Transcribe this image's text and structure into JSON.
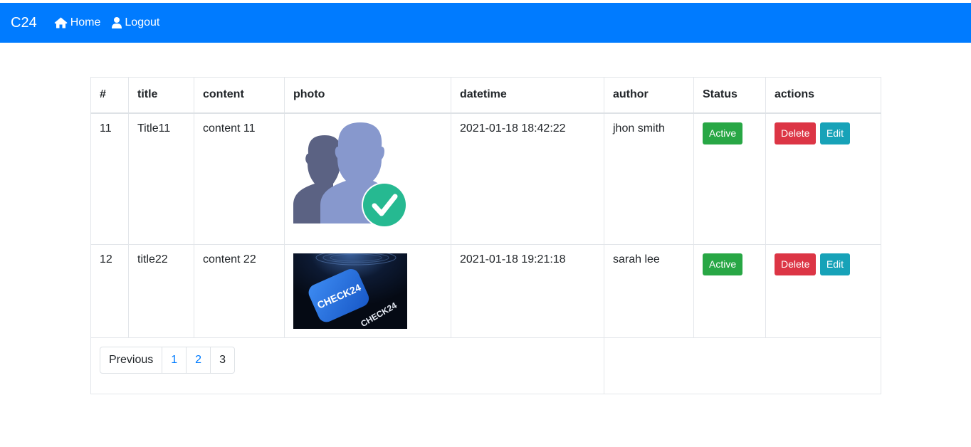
{
  "navbar": {
    "brand": "C24",
    "links": [
      {
        "label": "Home",
        "icon": "home-icon"
      },
      {
        "label": "Logout",
        "icon": "user-icon"
      }
    ],
    "color": "#007bff"
  },
  "table": {
    "headers": [
      "#",
      "title",
      "content",
      "photo",
      "datetime",
      "author",
      "Status",
      "actions"
    ],
    "rows": [
      {
        "id": "11",
        "title": "Title11",
        "content": "content 11",
        "photo_alt": "users-check-icon",
        "datetime": "2021-01-18 18:42:22",
        "author": "jhon smith",
        "status": "Active",
        "delete": "Delete",
        "edit": "Edit"
      },
      {
        "id": "12",
        "title": "title22",
        "content": "content 22",
        "photo_alt": "check24-logo",
        "photo_text": "CHECK24",
        "datetime": "2021-01-18 19:21:18",
        "author": "sarah lee",
        "status": "Active",
        "delete": "Delete",
        "edit": "Edit"
      }
    ]
  },
  "pagination": {
    "previous": "Previous",
    "pages": [
      "1",
      "2",
      "3"
    ]
  },
  "colors": {
    "success": "#28a745",
    "danger": "#dc3545",
    "info": "#17a2b8",
    "primary": "#007bff"
  }
}
